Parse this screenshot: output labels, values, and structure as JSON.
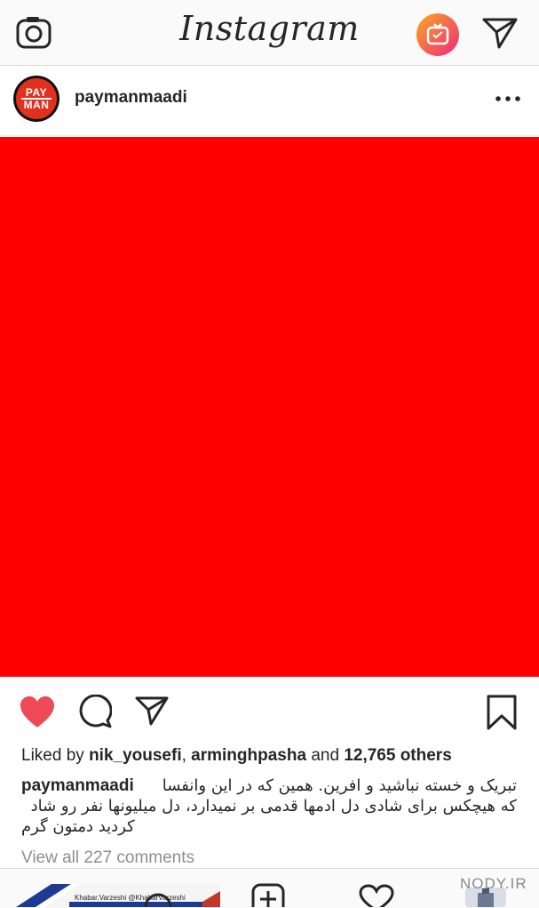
{
  "header": {
    "app_title": "Instagram"
  },
  "post": {
    "avatar_text_top": "PAY",
    "avatar_text_bottom": "MAN",
    "username": "paymanmaadi",
    "image_color": "#ff0000"
  },
  "likes": {
    "prefix": "Liked by",
    "user1": "nik_yousefi",
    "sep": ",",
    "user2": "arminghpasha",
    "and": "and",
    "count": "12,765 others"
  },
  "caption": {
    "username": "paymanmaadi",
    "line1": "تبریک و خسته نباشید و افرین. همین که در این وانفسا",
    "line2": "که هیچکس برای شادی دل ادمها قدمی بر نمیدارد، دل میلیونها نفر رو شاد",
    "line3": "کردید دمتون گرم"
  },
  "comments": {
    "view_all": "View all 227 comments"
  },
  "bottom": {
    "thumb_caption": "Khabar.Varzeshi  @KhabarVarzeshi",
    "watermark": "NODY.IR"
  },
  "icons": {
    "camera": "camera-icon",
    "igtv": "igtv-icon",
    "direct": "direct-message-icon",
    "more": "more-options-icon",
    "like": "heart-icon",
    "comment": "comment-icon",
    "share": "share-icon",
    "save": "bookmark-icon",
    "search": "search-icon",
    "add": "add-post-icon",
    "activity": "activity-heart-icon"
  },
  "colors": {
    "like_red": "#ed4956",
    "igtv_gradient_start": "#f9a825",
    "igtv_gradient_end": "#ee2a7b"
  }
}
